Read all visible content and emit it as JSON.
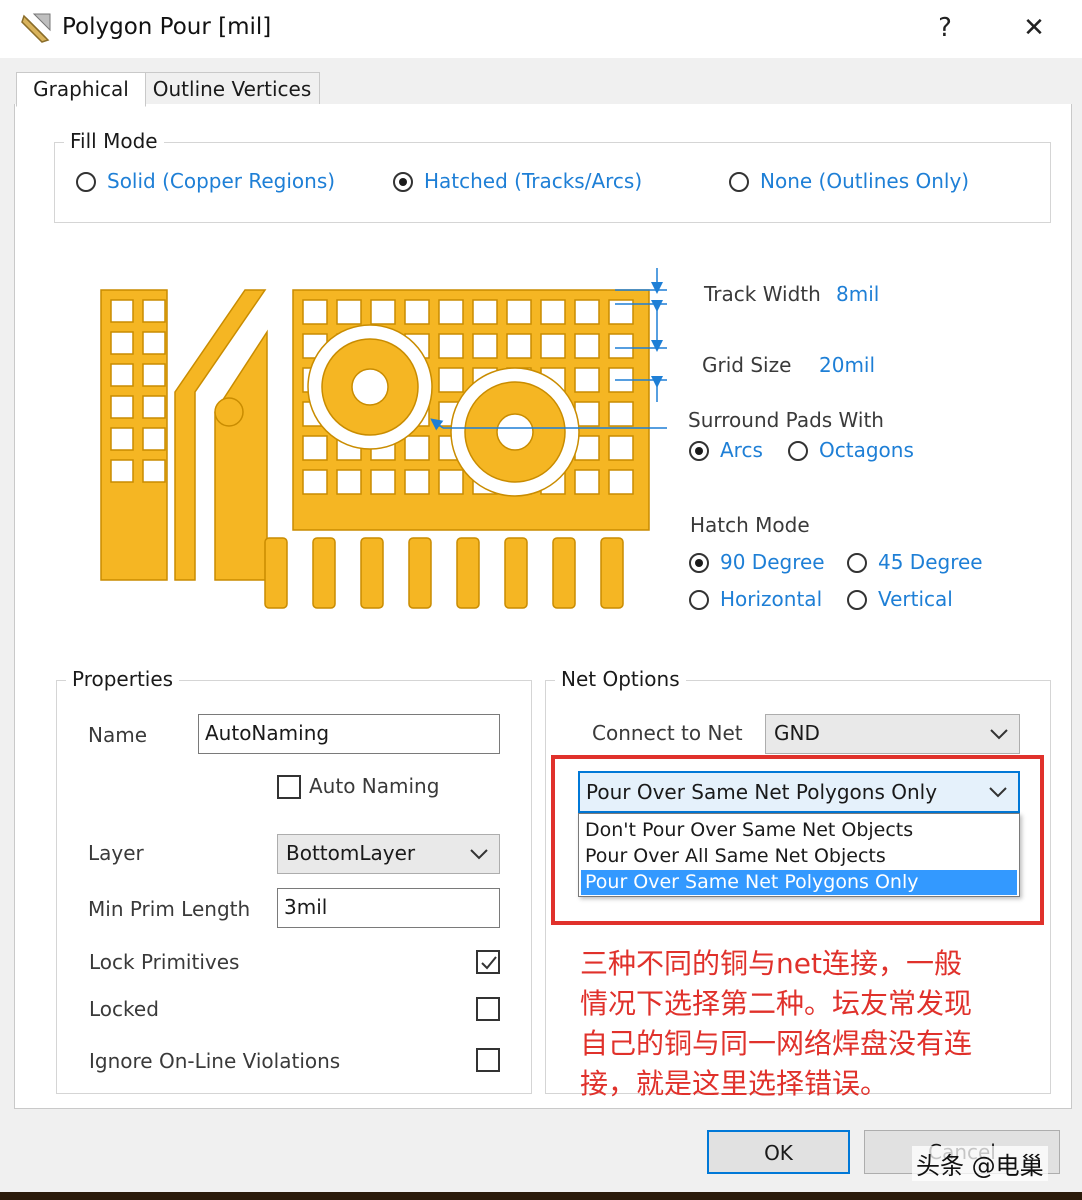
{
  "window": {
    "title": "Polygon Pour [mil]",
    "help_label": "?",
    "close_label": "✕",
    "app_icon": "polygon-pour-icon"
  },
  "tabs": [
    {
      "label": "Graphical"
    },
    {
      "label": "Outline Vertices"
    }
  ],
  "fill_mode": {
    "legend": "Fill Mode",
    "options": [
      {
        "label": "Solid (Copper Regions)",
        "checked": false
      },
      {
        "label": "Hatched (Tracks/Arcs)",
        "checked": true
      },
      {
        "label": "None (Outlines Only)",
        "checked": false
      }
    ]
  },
  "preview": {
    "copper_color": "#f5b623",
    "dimension_color": "#1e7fd6",
    "track_width_label": "Track Width",
    "track_width_value": "8mil",
    "grid_size_label": "Grid Size",
    "grid_size_value": "20mil"
  },
  "surround_pads": {
    "legend": "Surround Pads With",
    "options": [
      {
        "label": "Arcs",
        "checked": true
      },
      {
        "label": "Octagons",
        "checked": false
      }
    ]
  },
  "hatch_mode": {
    "legend": "Hatch Mode",
    "options": [
      {
        "label": "90 Degree",
        "checked": true
      },
      {
        "label": "45 Degree",
        "checked": false
      },
      {
        "label": "Horizontal",
        "checked": false
      },
      {
        "label": "Vertical",
        "checked": false
      }
    ]
  },
  "properties": {
    "legend": "Properties",
    "name_label": "Name",
    "name_value": "AutoNaming",
    "auto_naming_label": "Auto Naming",
    "auto_naming_checked": false,
    "layer_label": "Layer",
    "layer_value": "BottomLayer",
    "min_prim_label": "Min Prim Length",
    "min_prim_value": "3mil",
    "lock_primitives_label": "Lock Primitives",
    "lock_primitives_checked": true,
    "locked_label": "Locked",
    "locked_checked": false,
    "ignore_violations_label": "Ignore On-Line Violations",
    "ignore_violations_checked": false
  },
  "net_options": {
    "legend": "Net Options",
    "connect_label": "Connect to Net",
    "connect_value": "GND",
    "pour_selected": "Pour Over Same Net Polygons Only",
    "pour_options": [
      {
        "label": "Don't Pour Over Same Net Objects",
        "highlighted": false
      },
      {
        "label": "Pour Over All Same Net Objects",
        "highlighted": false
      },
      {
        "label": "Pour Over Same Net Polygons Only",
        "highlighted": true
      }
    ]
  },
  "annotation": {
    "color": "#e0312b",
    "lines": [
      "三种不同的铜与net连接，一般",
      "情况下选择第二种。坛友常发现",
      "自己的铜与同一网络焊盘没有连",
      "接，就是这里选择错误。"
    ]
  },
  "buttons": {
    "ok": "OK",
    "cancel": "Cancel"
  },
  "watermark": "头条 @电巢"
}
